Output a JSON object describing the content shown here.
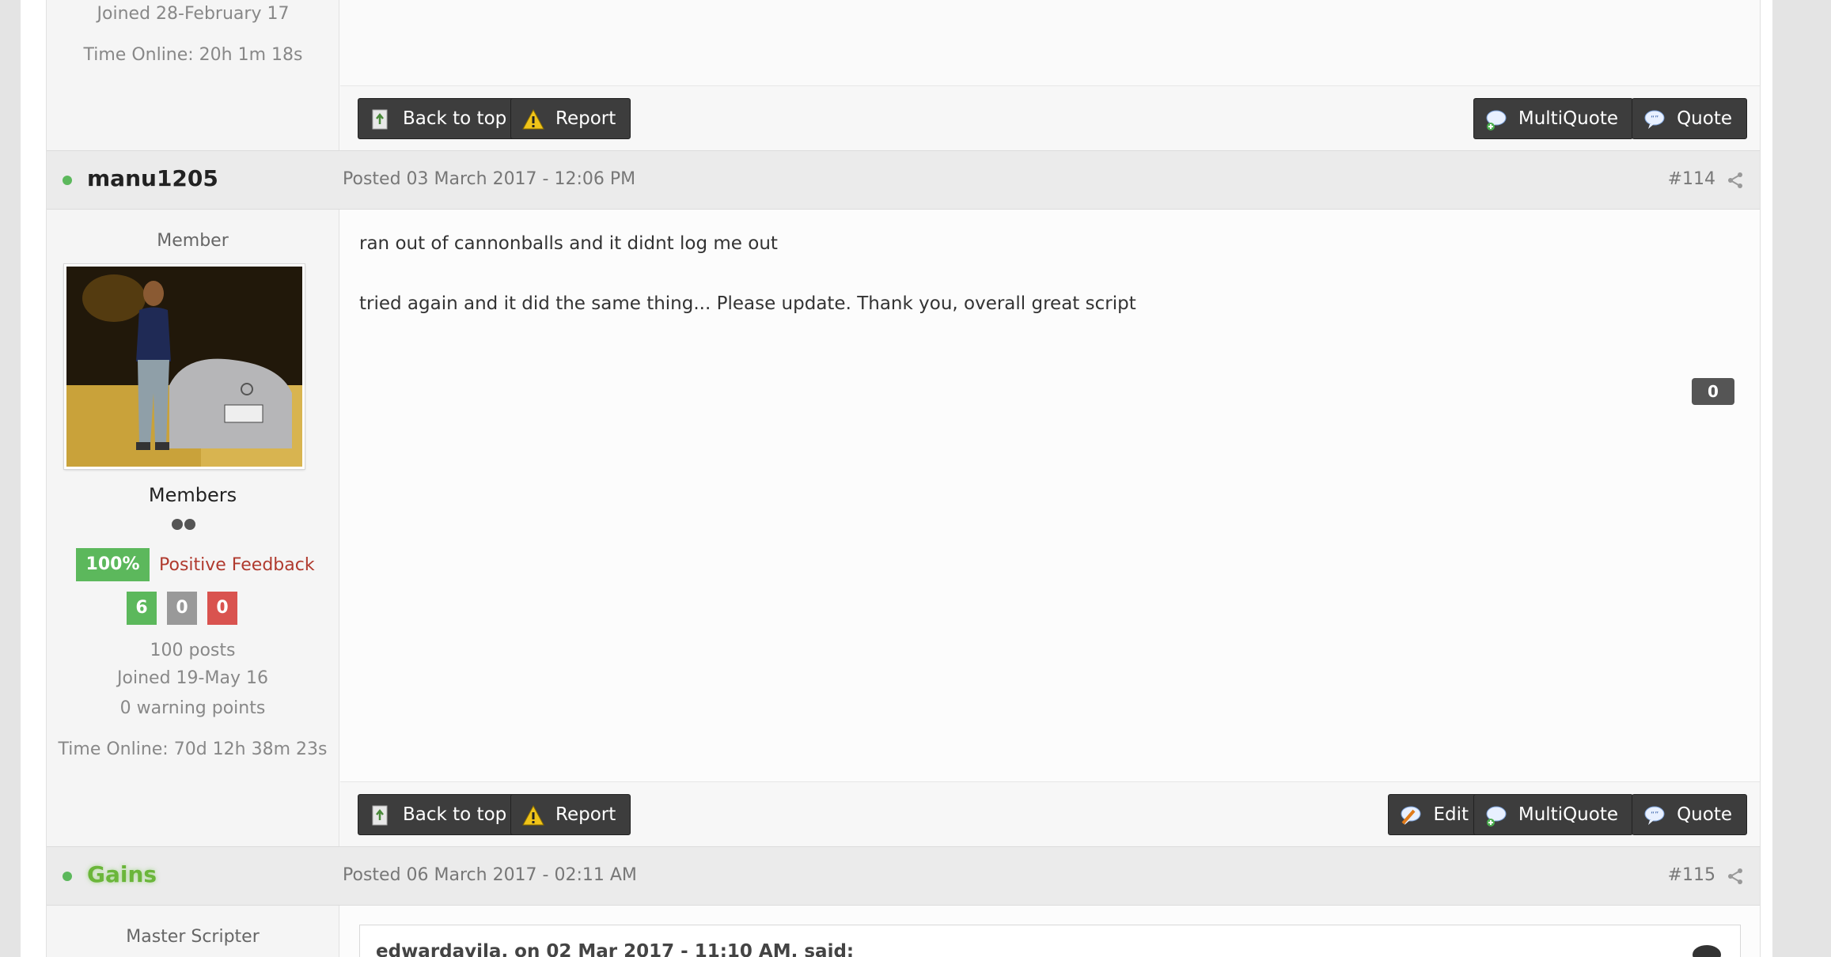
{
  "prev_post": {
    "joined": "Joined 28-February 17",
    "time_online": "Time Online: 20h 1m 18s",
    "actions": {
      "back_to_top": "Back to top",
      "report": "Report",
      "multiquote": "MultiQuote",
      "quote": "Quote"
    }
  },
  "post_114": {
    "author": "manu1205",
    "posted": "Posted 03 March 2017 - 12:06 PM",
    "post_number": "#114",
    "member_title": "Member",
    "group": "Members",
    "feedback_percent": "100%",
    "feedback_label": "Positive Feedback",
    "feedback_counts": {
      "positive": "6",
      "neutral": "0",
      "negative": "0"
    },
    "posts": "100 posts",
    "joined": "Joined 19-May 16",
    "warning_points": "0 warning points",
    "time_online": "Time Online: 70d 12h 38m 23s",
    "body_line_1": "ran out of cannonballs and it didnt log me out",
    "body_line_2": "tried again and it did the same thing... Please update. Thank you, overall great script",
    "reputation": "0",
    "actions": {
      "back_to_top": "Back to top",
      "report": "Report",
      "edit": "Edit",
      "multiquote": "MultiQuote",
      "quote": "Quote"
    }
  },
  "post_115": {
    "author": "Gains",
    "posted": "Posted 06 March 2017 - 02:11 AM",
    "post_number": "#115",
    "member_title": "Master Scripter",
    "quote_header": "edwardavila, on 02 Mar 2017 - 11:10 AM, said:"
  },
  "colors": {
    "online": "#5cb85c",
    "positive": "#5cb85c",
    "neutral": "#999999",
    "negative": "#d9534f",
    "button_bg": "#3d3d3d",
    "feedback_text": "#b03a2e"
  }
}
